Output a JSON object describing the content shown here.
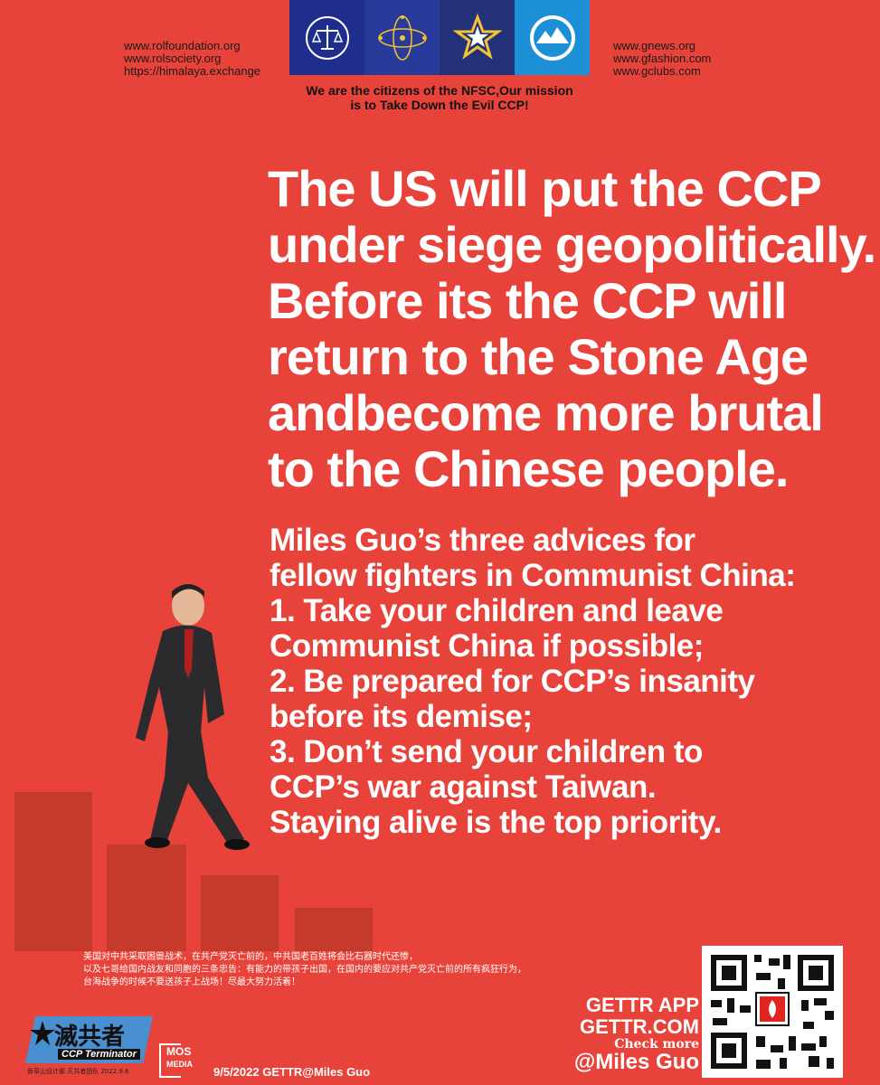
{
  "links_left": [
    "www.rolfoundation.org",
    "www.rolsociety.org",
    "https://himalaya.exchange"
  ],
  "links_right": [
    "www.gnews.org",
    "www.gfashion.com",
    "www.gclubs.com"
  ],
  "logos": [
    {
      "name": "rule-of-law-foundation-logo",
      "color": "#1f2e8c"
    },
    {
      "name": "new-federal-state-logo",
      "color": "#2a3a9a"
    },
    {
      "name": "star-emblem-logo",
      "color": "#233178"
    },
    {
      "name": "himalaya-logo",
      "color": "#1c8fd6"
    }
  ],
  "mission_lines": [
    "We are the citizens of the NFSC,Our mission",
    "is to Take Down the Evil CCP!"
  ],
  "headline_lines": [
    "The US will put the CCP",
    "under siege geopolitically.",
    "Before its the CCP will",
    "return to the Stone Age",
    "andbecome more brutal",
    "to the Chinese people."
  ],
  "advice_lines": [
    "Miles Guo’s three advices  for",
    "fellow fighters in Communist China:",
    "1. Take your children and leave",
    "Communist China if possible;",
    "2. Be prepared for CCP’s insanity",
    "before its demise;",
    "3. Don’t send your children to",
    "CCP’s war against Taiwan.",
    "Staying alive is the top priority."
  ],
  "chinese_lines": [
    "美国对中共采取困兽战术，在共产党灭亡前的，中共国老百姓将会比石器时代还惨，",
    "以及七哥给国内战友和同胞的三条忠告：有能力的带孩子出国，在国内的要应对共产党灭亡前的所有疯狂行为，",
    "台海战争的时候不要送孩子上战场！尽最大努力活着！"
  ],
  "gettr": {
    "app": "GETTR APP",
    "site": "GETTR.COM",
    "check": "Check more",
    "handle": "@Miles Guo"
  },
  "stamp": {
    "title": "滅共者",
    "subtitle": "CCP Terminator",
    "credit": "香草山设计部  灭共者团队 2022.9.6"
  },
  "mos_media": {
    "top": "MOS",
    "bottom": "MEDIA"
  },
  "footer_date": "9/5/2022 GETTR@Miles Guo",
  "colors": {
    "background": "#e8433a",
    "bars": "#c63a2c",
    "text": "#ffffff"
  }
}
